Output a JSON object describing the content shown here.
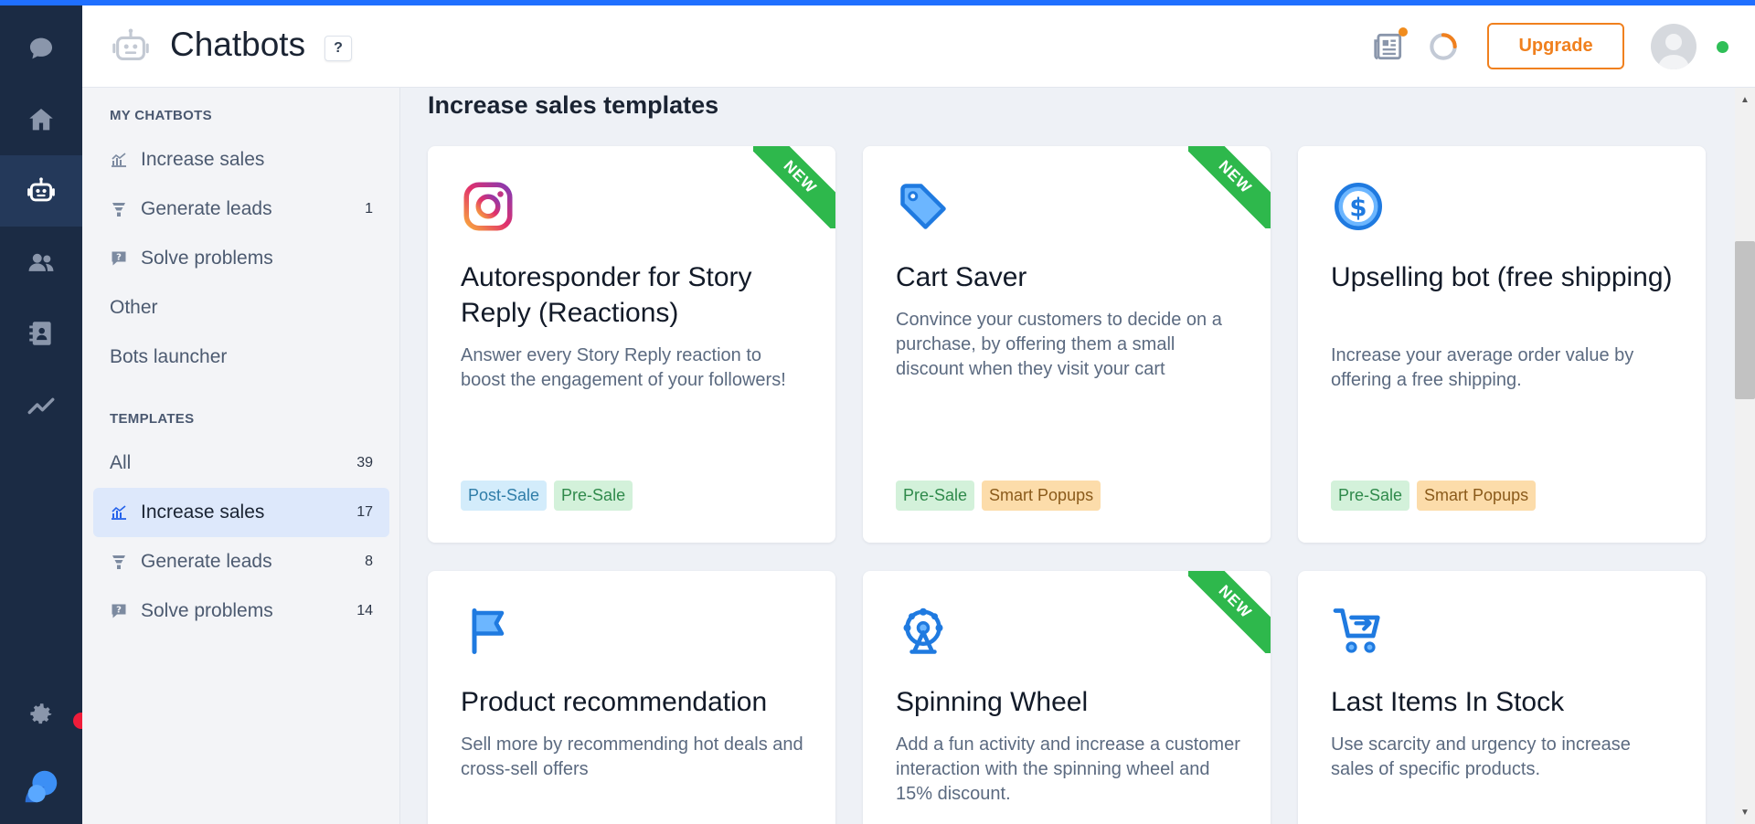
{
  "header": {
    "title": "Chatbots",
    "help_label": "?",
    "upgrade_label": "Upgrade"
  },
  "rail": {
    "items": [
      "chat-icon",
      "home-icon",
      "chatbot-icon",
      "contacts-icon",
      "address-book-icon",
      "analytics-icon"
    ],
    "bottom": [
      "settings-icon",
      "brand-logo-icon"
    ]
  },
  "sidebar": {
    "my_section": "MY CHATBOTS",
    "my_items": [
      {
        "label": "Increase sales",
        "count": ""
      },
      {
        "label": "Generate leads",
        "count": "1"
      },
      {
        "label": "Solve problems",
        "count": ""
      },
      {
        "label": "Other",
        "count": ""
      },
      {
        "label": "Bots launcher",
        "count": ""
      }
    ],
    "templates_section": "TEMPLATES",
    "template_items": [
      {
        "label": "All",
        "count": "39"
      },
      {
        "label": "Increase sales",
        "count": "17"
      },
      {
        "label": "Generate leads",
        "count": "8"
      },
      {
        "label": "Solve problems",
        "count": "14"
      }
    ]
  },
  "main": {
    "title": "Increase sales templates",
    "ribbon_label": "NEW",
    "cards": [
      {
        "title": "Autoresponder for Story Reply (Reactions)",
        "desc": "Answer every Story Reply reaction to boost the engagement of your followers!",
        "tags": [
          "Post-Sale",
          "Pre-Sale"
        ],
        "is_new": true,
        "icon": "instagram-icon"
      },
      {
        "title": "Cart Saver",
        "desc": "Convince your customers to decide on a purchase, by offering them a small discount when they visit your cart",
        "tags": [
          "Pre-Sale",
          "Smart Popups"
        ],
        "is_new": true,
        "icon": "price-tag-icon"
      },
      {
        "title": "Upselling bot (free shipping)",
        "desc": "Increase your average order value by offering a free shipping.",
        "tags": [
          "Pre-Sale",
          "Smart Popups"
        ],
        "is_new": false,
        "icon": "dollar-coin-icon"
      },
      {
        "title": "Product recommendation",
        "desc": "Sell more by recommending hot deals and cross-sell offers",
        "tags": [],
        "is_new": false,
        "icon": "flag-icon"
      },
      {
        "title": "Spinning Wheel",
        "desc": "Add a fun activity and increase a customer interaction with the spinning wheel and 15% discount.",
        "tags": [],
        "is_new": true,
        "icon": "ferris-wheel-icon"
      },
      {
        "title": "Last Items In Stock",
        "desc": "Use scarcity and urgency to increase sales of specific products.",
        "tags": [],
        "is_new": false,
        "icon": "cart-icon"
      }
    ]
  },
  "colors": {
    "accent": "#1f6fff",
    "rail_bg": "#1b2b44",
    "upgrade": "#f0801e",
    "new_ribbon": "#2eb84c"
  }
}
